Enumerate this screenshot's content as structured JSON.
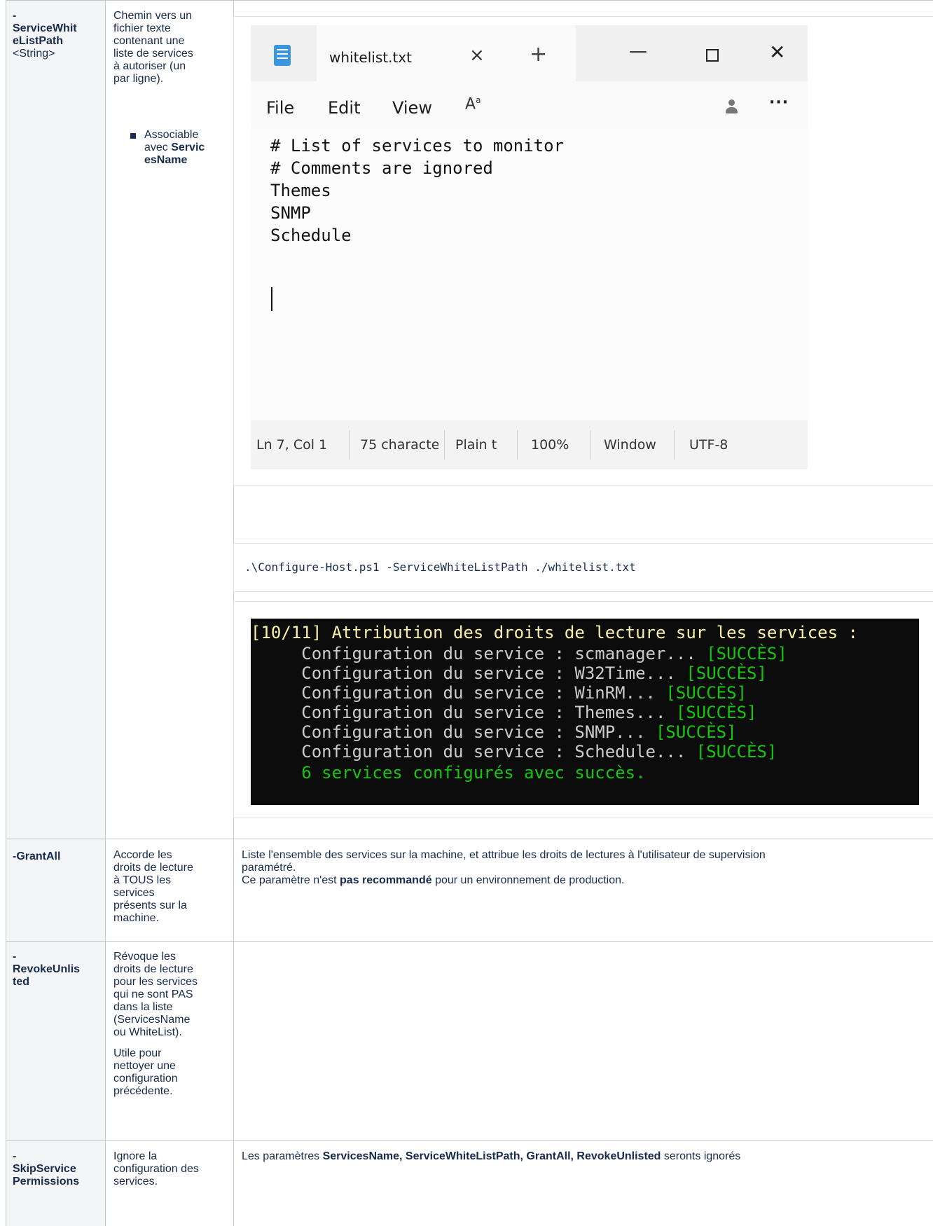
{
  "rows": [
    {
      "param_lines": [
        "-",
        "ServiceWhit",
        "eListPath"
      ],
      "param_type": "<String>",
      "desc_lines": [
        "Chemin vers un",
        "fichier texte",
        "contenant une",
        "liste de services",
        "à autoriser (un",
        "par ligne)."
      ],
      "bullet_lines_prefix": [
        "Associable",
        "avec "
      ],
      "bullet_bold_lines": [
        "Servic",
        "esName"
      ]
    },
    {
      "param": "-GrantAll",
      "desc_lines": [
        "Accorde les",
        "droits de lecture",
        "à TOUS les",
        "services",
        "présents sur la",
        "machine."
      ],
      "details_line1": "Liste l'ensemble des services sur la machine, et attribue les droits de lectures à l'utilisateur de supervision",
      "details_line2": "paramétré.",
      "details_line3_before": "Ce paramètre n'est ",
      "details_line3_bold": "pas recommandé",
      "details_line3_after": " pour un environnement de production."
    },
    {
      "param_lines": [
        "-",
        "RevokeUnlis",
        "ted"
      ],
      "desc_p1_lines": [
        "Révoque les",
        "droits de lecture",
        "pour les services",
        "qui ne sont PAS",
        "dans la liste",
        "(ServicesName",
        "ou WhiteList)."
      ],
      "desc_p2_lines": [
        "Utile pour",
        "nettoyer une",
        "configuration",
        "précédente."
      ]
    },
    {
      "param_lines": [
        "-",
        "SkipService",
        "Permissions"
      ],
      "desc_lines": [
        "Ignore la",
        "configuration des",
        "services."
      ],
      "details_before": "Les paramètres ",
      "details_bold": "ServicesName, ServiceWhiteListPath, GrantAll, RevokeUnlisted",
      "details_after": " seronts ignorés"
    }
  ],
  "notepad": {
    "tab_title": "whitelist.txt",
    "tab_close": "×",
    "new_tab": "+",
    "minimize": "—",
    "close": "✕",
    "menu": [
      "File",
      "Edit",
      "View"
    ],
    "format_icon": "A",
    "more": "···",
    "lines": [
      "# List of services to monitor",
      "# Comments are ignored",
      "Themes",
      "SNMP",
      "Schedule"
    ],
    "status": [
      "Ln 7, Col 1",
      "75 characte",
      "Plain t",
      "100%",
      "Window",
      "UTF-8"
    ]
  },
  "command": ".\\Configure-Host.ps1 -ServiceWhiteListPath ./whitelist.txt",
  "console": {
    "header": "[10/11] Attribution des droits de lecture sur les services :",
    "lines": [
      {
        "text": "     Configuration du service : scmanager... ",
        "status": "[SUCCÈS]"
      },
      {
        "text": "     Configuration du service : W32Time... ",
        "status": "[SUCCÈS]"
      },
      {
        "text": "     Configuration du service : WinRM... ",
        "status": "[SUCCÈS]"
      },
      {
        "text": "     Configuration du service : Themes... ",
        "status": "[SUCCÈS]"
      },
      {
        "text": "     Configuration du service : SNMP... ",
        "status": "[SUCCÈS]"
      },
      {
        "text": "     Configuration du service : Schedule... ",
        "status": "[SUCCÈS]"
      }
    ],
    "summary": "     6 services configurés avec succès."
  }
}
